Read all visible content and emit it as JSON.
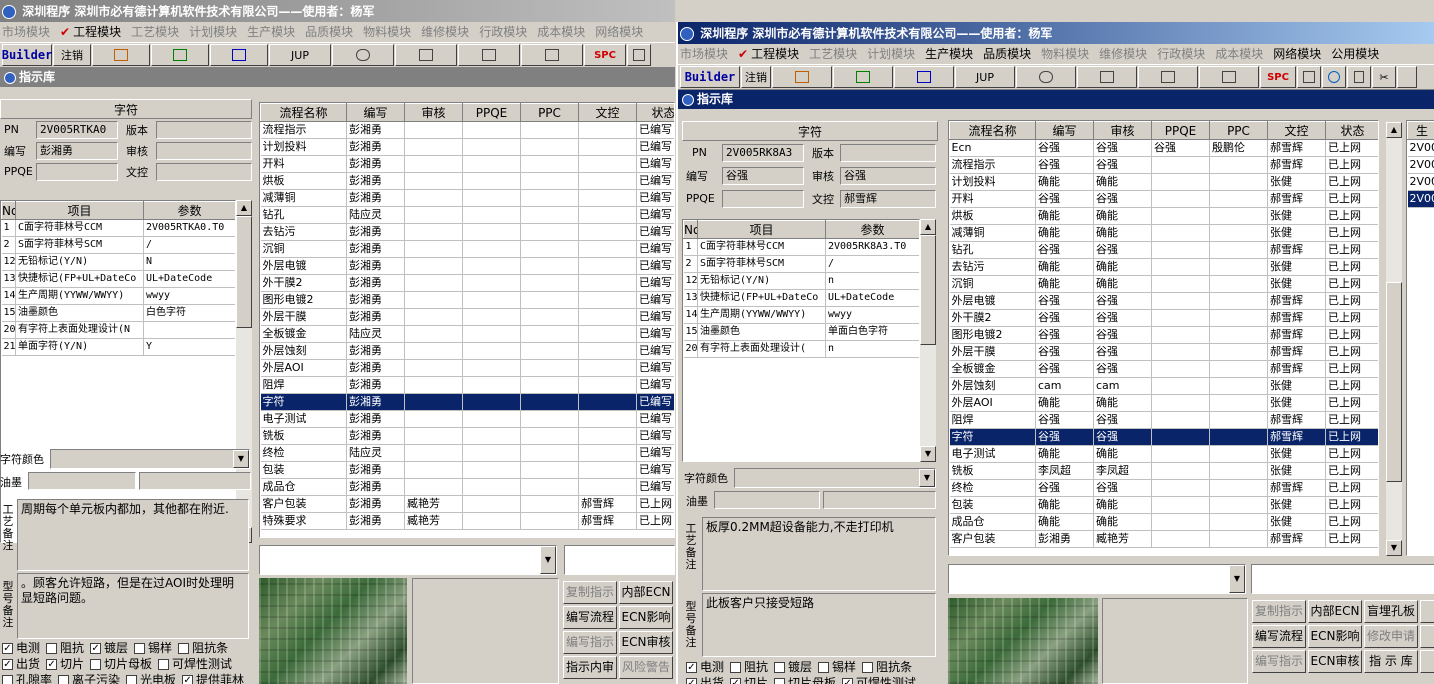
{
  "win1": {
    "title": "深圳程序  深圳市必有德计算机软件技术有限公司——使用者：杨军",
    "menu": [
      "市场模块",
      "工程模块",
      "工艺模块",
      "计划模块",
      "生产模块",
      "品质模块",
      "物料模块",
      "维修模块",
      "行政模块",
      "成本模块",
      "网络模块"
    ],
    "toolbar": {
      "builder": "Builder",
      "logout": "注销",
      "jup": "JUP",
      "spc": "SPC"
    },
    "subtitle": "指示库",
    "section": "字符",
    "fields": {
      "pn_label": "PN",
      "pn": "2V005RTKA0",
      "version_label": "版本",
      "version": "",
      "writer_label": "编写",
      "writer": "彭湘勇",
      "audit_label": "审核",
      "audit": "",
      "ppqe_label": "PPQE",
      "ppqe": "",
      "doc_label": "文控",
      "doc": ""
    },
    "param_headers": [
      "No",
      "项目",
      "参数"
    ],
    "params": [
      [
        "1",
        "C面字符菲林号CCM",
        "2V005RTKA0.T0"
      ],
      [
        "2",
        "S面字符菲林号SCM",
        "/"
      ],
      [
        "12",
        "无铅标记(Y/N)",
        "N"
      ],
      [
        "13",
        "快捷标记(FP+UL+DateCo",
        "UL+DateCode"
      ],
      [
        "14",
        "生产周期(YYWW/WWYY)",
        "wwyy"
      ],
      [
        "15",
        "油墨颜色",
        "白色字符"
      ],
      [
        "20",
        "有字符上表面处理设计(N",
        ""
      ],
      [
        "21",
        "单面字符(Y/N)",
        "Y"
      ]
    ],
    "char_color_label": "字符颜色",
    "ink_label": "油墨",
    "craft_note_label": "工艺备注",
    "craft_note": "周期每个单元板内都加，其他都在附近.",
    "model_note_label": "型号备注",
    "model_note": "。顾客允许短路，但是在过AOI时处理明显短路问题。",
    "flow_headers": [
      "流程名称",
      "编写",
      "审核",
      "PPQE",
      "PPC",
      "文控",
      "状态"
    ],
    "flows": [
      [
        "流程指示",
        "彭湘勇",
        "",
        "",
        "",
        "",
        "已编写"
      ],
      [
        "计划投料",
        "彭湘勇",
        "",
        "",
        "",
        "",
        "已编写"
      ],
      [
        "开料",
        "彭湘勇",
        "",
        "",
        "",
        "",
        "已编写"
      ],
      [
        "烘板",
        "彭湘勇",
        "",
        "",
        "",
        "",
        "已编写"
      ],
      [
        "减薄铜",
        "彭湘勇",
        "",
        "",
        "",
        "",
        "已编写"
      ],
      [
        "钻孔",
        "陆应灵",
        "",
        "",
        "",
        "",
        "已编写"
      ],
      [
        "去钻污",
        "彭湘勇",
        "",
        "",
        "",
        "",
        "已编写"
      ],
      [
        "沉铜",
        "彭湘勇",
        "",
        "",
        "",
        "",
        "已编写"
      ],
      [
        "外层电镀",
        "彭湘勇",
        "",
        "",
        "",
        "",
        "已编写"
      ],
      [
        "外干膜2",
        "彭湘勇",
        "",
        "",
        "",
        "",
        "已编写"
      ],
      [
        "图形电镀2",
        "彭湘勇",
        "",
        "",
        "",
        "",
        "已编写"
      ],
      [
        "外层干膜",
        "彭湘勇",
        "",
        "",
        "",
        "",
        "已编写"
      ],
      [
        "全板镀金",
        "陆应灵",
        "",
        "",
        "",
        "",
        "已编写"
      ],
      [
        "外层蚀刻",
        "彭湘勇",
        "",
        "",
        "",
        "",
        "已编写"
      ],
      [
        "外层AOI",
        "彭湘勇",
        "",
        "",
        "",
        "",
        "已编写"
      ],
      [
        "阻焊",
        "彭湘勇",
        "",
        "",
        "",
        "",
        "已编写"
      ],
      [
        "字符",
        "彭湘勇",
        "",
        "",
        "",
        "",
        "已编写"
      ],
      [
        "电子测试",
        "彭湘勇",
        "",
        "",
        "",
        "",
        "已编写"
      ],
      [
        "铣板",
        "彭湘勇",
        "",
        "",
        "",
        "",
        "已编写"
      ],
      [
        "终检",
        "陆应灵",
        "",
        "",
        "",
        "",
        "已编写"
      ],
      [
        "包装",
        "彭湘勇",
        "",
        "",
        "",
        "",
        "已编写"
      ],
      [
        "成品仓",
        "彭湘勇",
        "",
        "",
        "",
        "",
        "已编写"
      ],
      [
        "客户包装",
        "彭湘勇",
        "臧艳芳",
        "",
        "",
        "郝雪辉",
        "已上网"
      ],
      [
        "特殊要求",
        "彭湘勇",
        "臧艳芳",
        "",
        "",
        "郝雪辉",
        "已上网"
      ]
    ],
    "selected_flow": 16,
    "checks_row1": [
      [
        "电测",
        true
      ],
      [
        "阻抗",
        false
      ],
      [
        "镀层",
        true
      ],
      [
        "锡样",
        false
      ],
      [
        "阻抗条",
        false
      ]
    ],
    "checks_row2": [
      [
        "出货",
        true
      ],
      [
        "切片",
        true
      ],
      [
        "切片母板",
        false
      ],
      [
        "可焊性测试",
        false
      ]
    ],
    "checks_row3": [
      [
        "孔隙率",
        false
      ],
      [
        "离子污染",
        false
      ],
      [
        "光电板",
        false
      ],
      [
        "提供菲林",
        true
      ]
    ],
    "buttons": [
      [
        "复制指示",
        true
      ],
      [
        "内部ECN",
        false
      ],
      [
        "编写流程",
        false
      ],
      [
        "ECN影响",
        false
      ],
      [
        "编写指示",
        true
      ],
      [
        "ECN审核",
        false
      ],
      [
        "指示内审",
        false
      ],
      [
        "风险警告",
        true
      ]
    ]
  },
  "win2": {
    "title": "深圳程序  深圳市必有德计算机软件技术有限公司——使用者：杨军",
    "menu": [
      "市场模块",
      "工程模块",
      "工艺模块",
      "计划模块",
      "生产模块",
      "品质模块",
      "物料模块",
      "维修模块",
      "行政模块",
      "成本模块",
      "网络模块",
      "公用模块"
    ],
    "toolbar": {
      "builder": "Builder",
      "logout": "注销",
      "jup": "JUP",
      "spc": "SPC"
    },
    "subtitle": "指示库",
    "section": "字符",
    "fields": {
      "pn_label": "PN",
      "pn": "2V005RK8A3",
      "version_label": "版本",
      "version": "",
      "writer_label": "编写",
      "writer": "谷强",
      "audit_label": "审核",
      "audit": "谷强",
      "ppqe_label": "PPQE",
      "ppqe": "",
      "doc_label": "文控",
      "doc": "郝雪辉"
    },
    "param_headers": [
      "No",
      "项目",
      "参数"
    ],
    "params": [
      [
        "1",
        "C面字符菲林号CCM",
        "2V005RK8A3.T0"
      ],
      [
        "2",
        "S面字符菲林号SCM",
        "/"
      ],
      [
        "12",
        "无铅标记(Y/N)",
        "n"
      ],
      [
        "13",
        "快捷标记(FP+UL+DateCo",
        "UL+DateCode"
      ],
      [
        "14",
        "生产周期(YYWW/WWYY)",
        "wwyy"
      ],
      [
        "15",
        "油墨颜色",
        "单面白色字符"
      ],
      [
        "20",
        "有字符上表面处理设计(",
        "n"
      ]
    ],
    "char_color_label": "字符颜色",
    "ink_label": "油墨",
    "craft_note_label": "工艺备注",
    "craft_note": "板厚0.2MM超设备能力,不走打印机",
    "model_note_label": "型号备注",
    "model_note": "此板客户只接受短路",
    "flow_headers": [
      "流程名称",
      "编写",
      "审核",
      "PPQE",
      "PPC",
      "文控",
      "状态"
    ],
    "flows": [
      [
        "Ecn",
        "谷强",
        "谷强",
        "谷强",
        "殷鹏伦",
        "郝雪辉",
        "已上网"
      ],
      [
        "流程指示",
        "谷强",
        "谷强",
        "",
        "",
        "郝雪辉",
        "已上网"
      ],
      [
        "计划投料",
        "确能",
        "确能",
        "",
        "",
        "张健",
        "已上网"
      ],
      [
        "开料",
        "谷强",
        "谷强",
        "",
        "",
        "郝雪辉",
        "已上网"
      ],
      [
        "烘板",
        "确能",
        "确能",
        "",
        "",
        "张健",
        "已上网"
      ],
      [
        "减薄铜",
        "确能",
        "确能",
        "",
        "",
        "张健",
        "已上网"
      ],
      [
        "钻孔",
        "谷强",
        "谷强",
        "",
        "",
        "郝雪辉",
        "已上网"
      ],
      [
        "去钻污",
        "确能",
        "确能",
        "",
        "",
        "张健",
        "已上网"
      ],
      [
        "沉铜",
        "确能",
        "确能",
        "",
        "",
        "张健",
        "已上网"
      ],
      [
        "外层电镀",
        "谷强",
        "谷强",
        "",
        "",
        "郝雪辉",
        "已上网"
      ],
      [
        "外干膜2",
        "谷强",
        "谷强",
        "",
        "",
        "郝雪辉",
        "已上网"
      ],
      [
        "图形电镀2",
        "谷强",
        "谷强",
        "",
        "",
        "郝雪辉",
        "已上网"
      ],
      [
        "外层干膜",
        "谷强",
        "谷强",
        "",
        "",
        "郝雪辉",
        "已上网"
      ],
      [
        "全板镀金",
        "谷强",
        "谷强",
        "",
        "",
        "郝雪辉",
        "已上网"
      ],
      [
        "外层蚀刻",
        "cam",
        "cam",
        "",
        "",
        "张健",
        "已上网"
      ],
      [
        "外层AOI",
        "确能",
        "确能",
        "",
        "",
        "张健",
        "已上网"
      ],
      [
        "阻焊",
        "谷强",
        "谷强",
        "",
        "",
        "郝雪辉",
        "已上网"
      ],
      [
        "字符",
        "谷强",
        "谷强",
        "",
        "",
        "郝雪辉",
        "已上网"
      ],
      [
        "电子测试",
        "确能",
        "确能",
        "",
        "",
        "张健",
        "已上网"
      ],
      [
        "铣板",
        "李凤超",
        "李凤超",
        "",
        "",
        "张健",
        "已上网"
      ],
      [
        "终检",
        "谷强",
        "谷强",
        "",
        "",
        "郝雪辉",
        "已上网"
      ],
      [
        "包装",
        "确能",
        "确能",
        "",
        "",
        "张健",
        "已上网"
      ],
      [
        "成品仓",
        "确能",
        "确能",
        "",
        "",
        "张健",
        "已上网"
      ],
      [
        "客户包装",
        "彭湘勇",
        "臧艳芳",
        "",
        "",
        "郝雪辉",
        "已上网"
      ]
    ],
    "selected_flow": 17,
    "right_list_header": "生",
    "right_list": [
      "2V00",
      "2V00",
      "2V00",
      "2V00"
    ],
    "right_list_selected": 3,
    "checks_row1": [
      [
        "电测",
        true
      ],
      [
        "阻抗",
        false
      ],
      [
        "镀层",
        false
      ],
      [
        "锡样",
        false
      ],
      [
        "阻抗条",
        false
      ]
    ],
    "checks_row2": [
      [
        "出货",
        true
      ],
      [
        "切片",
        true
      ],
      [
        "切片母板",
        false
      ],
      [
        "可焊性测试",
        true
      ]
    ],
    "buttons": [
      [
        "复制指示",
        true
      ],
      [
        "内部ECN",
        false
      ],
      [
        "盲埋孔板",
        false
      ],
      [
        "报",
        true
      ],
      [
        "编写流程",
        false
      ],
      [
        "ECN影响",
        false
      ],
      [
        "修改申请",
        true
      ],
      [
        "合",
        true
      ],
      [
        "编写指示",
        true
      ],
      [
        "ECN审核",
        false
      ],
      [
        "指 示 库",
        false
      ],
      [
        "稍",
        true
      ]
    ]
  }
}
